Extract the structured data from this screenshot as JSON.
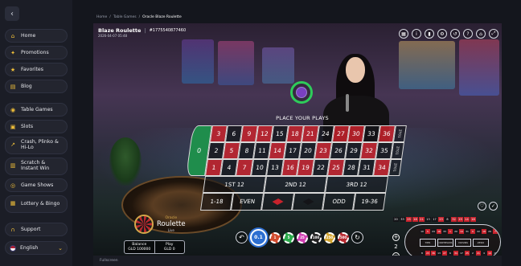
{
  "sidebar": {
    "collapse_icon": "chevron-left-icon",
    "items": [
      {
        "label": "Home",
        "icon": "home-icon"
      },
      {
        "label": "Promotions",
        "icon": "gift-icon"
      },
      {
        "label": "Favorites",
        "icon": "star-icon"
      },
      {
        "label": "Blog",
        "icon": "blog-icon"
      },
      {
        "label": "Table Games",
        "icon": "table-games-icon"
      },
      {
        "label": "Slots",
        "icon": "slots-icon"
      },
      {
        "label": "Crash, Plinko & Hi-Lo",
        "icon": "crash-icon"
      },
      {
        "label": "Scratch & Instant Win",
        "icon": "scratch-icon"
      },
      {
        "label": "Game Shows",
        "icon": "game-shows-icon"
      },
      {
        "label": "Lottery & Bingo",
        "icon": "lottery-icon"
      },
      {
        "label": "Support",
        "icon": "headset-icon"
      }
    ],
    "language": "English"
  },
  "breadcrumb": [
    "Home",
    "Table Games",
    "Oracle Blaze Roulette"
  ],
  "game": {
    "title": "Blaze Roulette",
    "round_id": "#1775540877460",
    "datetime": "2026-04-07 05:48",
    "status": "PLACE YOUR PLAYS"
  },
  "table": {
    "zero": "0",
    "rows": [
      [
        {
          "n": "3",
          "c": "red"
        },
        {
          "n": "6",
          "c": "black"
        },
        {
          "n": "9",
          "c": "red"
        },
        {
          "n": "12",
          "c": "red"
        },
        {
          "n": "15",
          "c": "black"
        },
        {
          "n": "18",
          "c": "red"
        },
        {
          "n": "21",
          "c": "red"
        },
        {
          "n": "24",
          "c": "black"
        },
        {
          "n": "27",
          "c": "red"
        },
        {
          "n": "30",
          "c": "red"
        },
        {
          "n": "33",
          "c": "black"
        },
        {
          "n": "36",
          "c": "red"
        }
      ],
      [
        {
          "n": "2",
          "c": "black"
        },
        {
          "n": "5",
          "c": "red"
        },
        {
          "n": "8",
          "c": "black"
        },
        {
          "n": "11",
          "c": "black"
        },
        {
          "n": "14",
          "c": "red"
        },
        {
          "n": "17",
          "c": "black"
        },
        {
          "n": "20",
          "c": "black"
        },
        {
          "n": "23",
          "c": "red"
        },
        {
          "n": "26",
          "c": "black"
        },
        {
          "n": "29",
          "c": "black"
        },
        {
          "n": "32",
          "c": "red"
        },
        {
          "n": "35",
          "c": "black"
        }
      ],
      [
        {
          "n": "1",
          "c": "red"
        },
        {
          "n": "4",
          "c": "black"
        },
        {
          "n": "7",
          "c": "red"
        },
        {
          "n": "10",
          "c": "black"
        },
        {
          "n": "13",
          "c": "black"
        },
        {
          "n": "16",
          "c": "red"
        },
        {
          "n": "19",
          "c": "red"
        },
        {
          "n": "22",
          "c": "black"
        },
        {
          "n": "25",
          "c": "red"
        },
        {
          "n": "28",
          "c": "black"
        },
        {
          "n": "31",
          "c": "black"
        },
        {
          "n": "34",
          "c": "red"
        }
      ]
    ],
    "columns": [
      "2TO1",
      "2TO1",
      "2TO1"
    ],
    "dozens": [
      "1ST 12",
      "2ND 12",
      "3RD 12"
    ],
    "outside": [
      "1-18",
      "EVEN",
      "",
      "",
      "ODD",
      "19-36"
    ],
    "red_color": "#c8222c",
    "black_color": "#141418",
    "green_color": "#1f8d4c"
  },
  "recent_numbers": [
    {
      "n": "20",
      "c": "#141418"
    },
    {
      "n": "33",
      "c": "#141418"
    },
    {
      "n": "25",
      "c": "#c8222c"
    },
    {
      "n": "18",
      "c": "#c8222c"
    },
    {
      "n": "21",
      "c": "#c8222c"
    },
    {
      "n": "13",
      "c": "#141418"
    },
    {
      "n": "17",
      "c": "#141418"
    },
    {
      "n": "23",
      "c": "#c8222c"
    },
    {
      "n": "8",
      "c": "#141418"
    },
    {
      "n": "32",
      "c": "#c8222c"
    },
    {
      "n": "19",
      "c": "#c8222c"
    },
    {
      "n": "14",
      "c": "#c8222c"
    },
    {
      "n": "18",
      "c": "#c8222c"
    }
  ],
  "racetrack": {
    "top": [
      "10",
      "5",
      "24",
      "16",
      "33",
      "1",
      "20",
      "14",
      "31",
      "9",
      "22",
      "18",
      "29",
      "7",
      "28"
    ],
    "bottom": [
      "8",
      "23",
      "36",
      "13",
      "27",
      "6",
      "34",
      "17",
      "25",
      "2",
      "21",
      "4",
      "19",
      "15",
      "32"
    ],
    "sections": [
      "TIER",
      "ORPHELINS",
      "VOISINS",
      "ZERO"
    ],
    "neighbors": "2"
  },
  "branding": {
    "provider": "Oracle",
    "name": "Roulette",
    "tag": "Live"
  },
  "wallet": {
    "balance_label": "Balance",
    "balance_value": "GLD 100000",
    "play_label": "Play",
    "play_value": "GLD 0"
  },
  "chips": [
    {
      "label": "0.1",
      "color": "#2d6fd1",
      "selected": true
    },
    {
      "label": "1",
      "color": "#d14a2d"
    },
    {
      "label": "5",
      "color": "#2aa94a"
    },
    {
      "label": "25",
      "color": "#d13fb3"
    },
    {
      "label": "100",
      "color": "#222222"
    },
    {
      "label": "250",
      "color": "#d1a32d"
    },
    {
      "label": "500",
      "color": "#b8282e"
    }
  ],
  "footer": "Fullscreen"
}
